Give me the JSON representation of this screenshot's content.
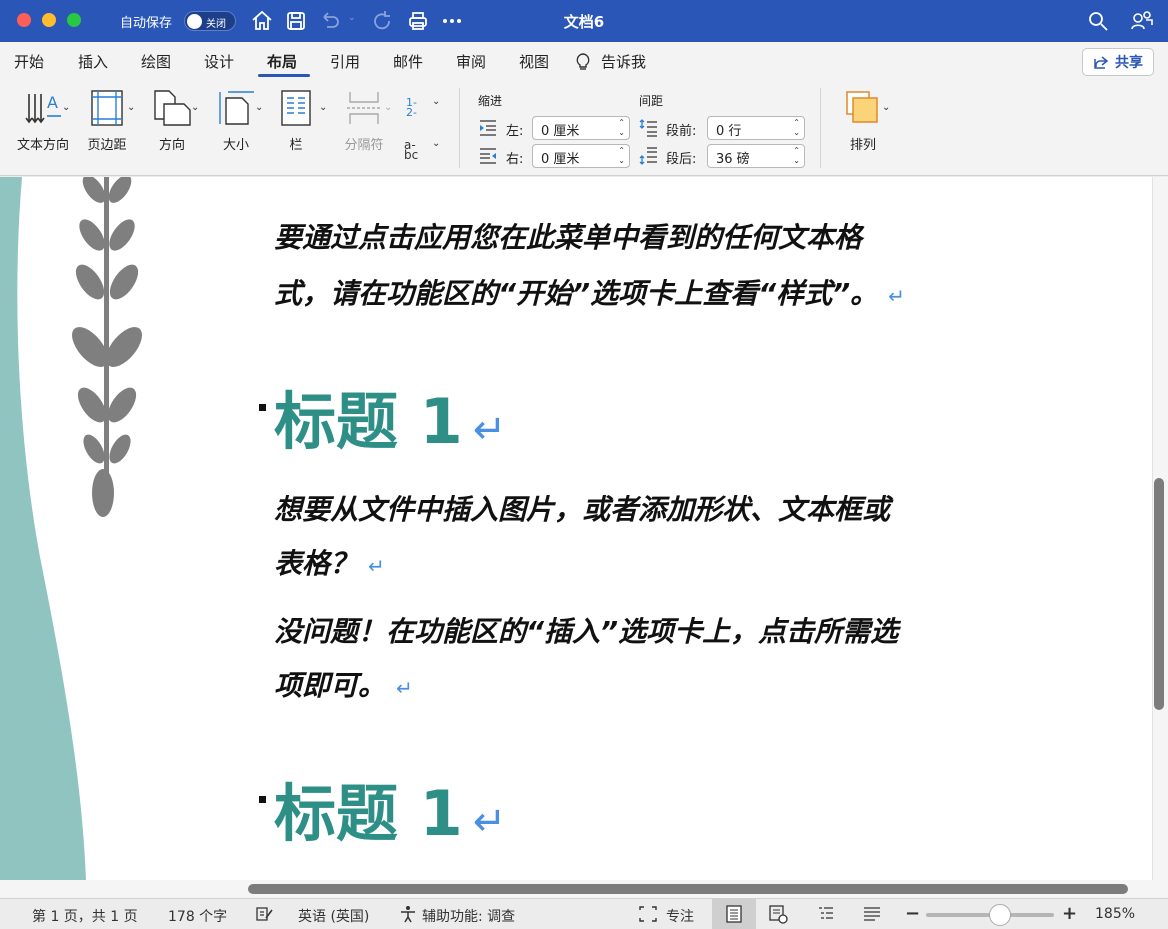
{
  "titlebar": {
    "autosave_label": "自动保存",
    "autosave_state": "关闭",
    "doc_title": "文档6",
    "icons": [
      "home-icon",
      "save-icon",
      "undo-icon",
      "redo-icon",
      "print-icon",
      "more-icon",
      "search-icon",
      "account-icon"
    ]
  },
  "tabs": {
    "items": [
      "开始",
      "插入",
      "绘图",
      "设计",
      "布局",
      "引用",
      "邮件",
      "审阅",
      "视图",
      "告诉我"
    ],
    "active": "布局",
    "share_label": "共享"
  },
  "ribbon": {
    "text_direction": "文本方向",
    "margins": "页边距",
    "orientation": "方向",
    "size": "大小",
    "columns": "栏",
    "breaks": "分隔符",
    "indent_title": "缩进",
    "spacing_title": "间距",
    "indent_left_label": "左:",
    "indent_left_value": "0 厘米",
    "indent_right_label": "右:",
    "indent_right_value": "0 厘米",
    "spacing_before_label": "段前:",
    "spacing_before_value": "0 行",
    "spacing_after_label": "段后:",
    "spacing_after_value": "36 磅",
    "arrange": "排列",
    "line_numbers_icon": "1- 2-",
    "hyphenation_icon": "a- bc"
  },
  "document": {
    "para1_line1": "要通过点击应用您在此菜单中看到的任何文本格",
    "para1_line2": "式，请在功能区的“开始”选项卡上查看“样式”。",
    "heading1": "标题 1",
    "para2_line1": "想要从文件中插入图片，或者添加形状、文本框或",
    "para2_line2": "表格？",
    "para3_line1": "没问题！在功能区的“插入”选项卡上，点击所需选",
    "para3_line2": "项即可。",
    "heading2": "标题 1",
    "return_mark": "↵",
    "accent_color": "#2e8f87",
    "teal_color": "#8fc4c1"
  },
  "statusbar": {
    "page": "第 1 页，共 1 页",
    "words": "178 个字",
    "language": "英语 (英国)",
    "accessibility": "辅助功能: 调查",
    "focus": "专注",
    "zoom": "185%",
    "zoom_minus": "−",
    "zoom_plus": "+"
  }
}
